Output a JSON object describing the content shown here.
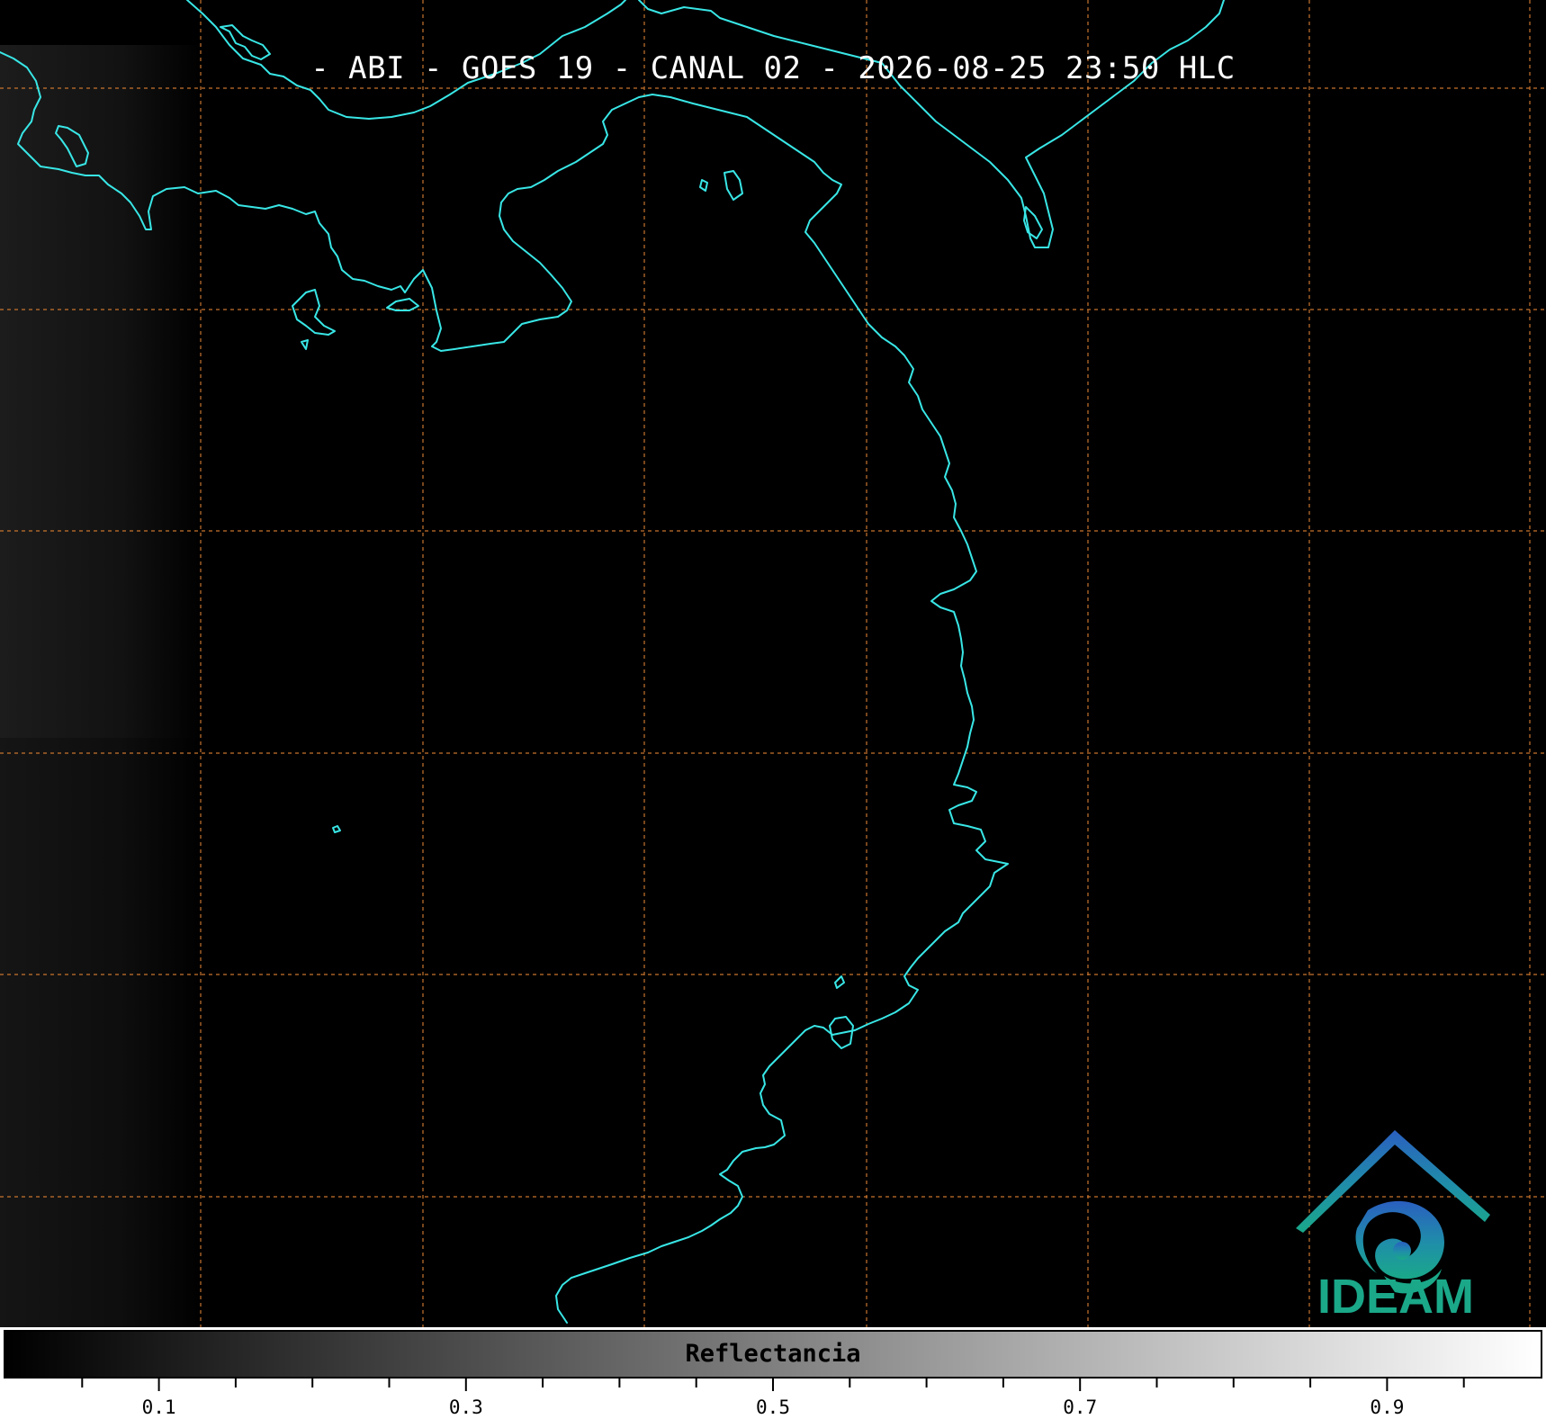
{
  "title": "- ABI - GOES 19 - CANAL 02 - 2026-08-25 23:50 HLC",
  "logo_text": "IDEAM",
  "colorbar": {
    "label": "Reflectancia",
    "range": [
      0.0,
      1.0
    ],
    "colormap": "gray",
    "tick_labels": [
      "0.1",
      "0.3",
      "0.5",
      "0.7",
      "0.9"
    ]
  },
  "colors": {
    "coastline": "#39e6e6",
    "gridlines": "#c8742e",
    "background": "#000000",
    "logo_green": "#1aa889",
    "logo_blue": "#2a6fc0"
  },
  "map": {
    "gridlines": "dashed",
    "region": "Panama and Pacific coast of Colombia"
  }
}
